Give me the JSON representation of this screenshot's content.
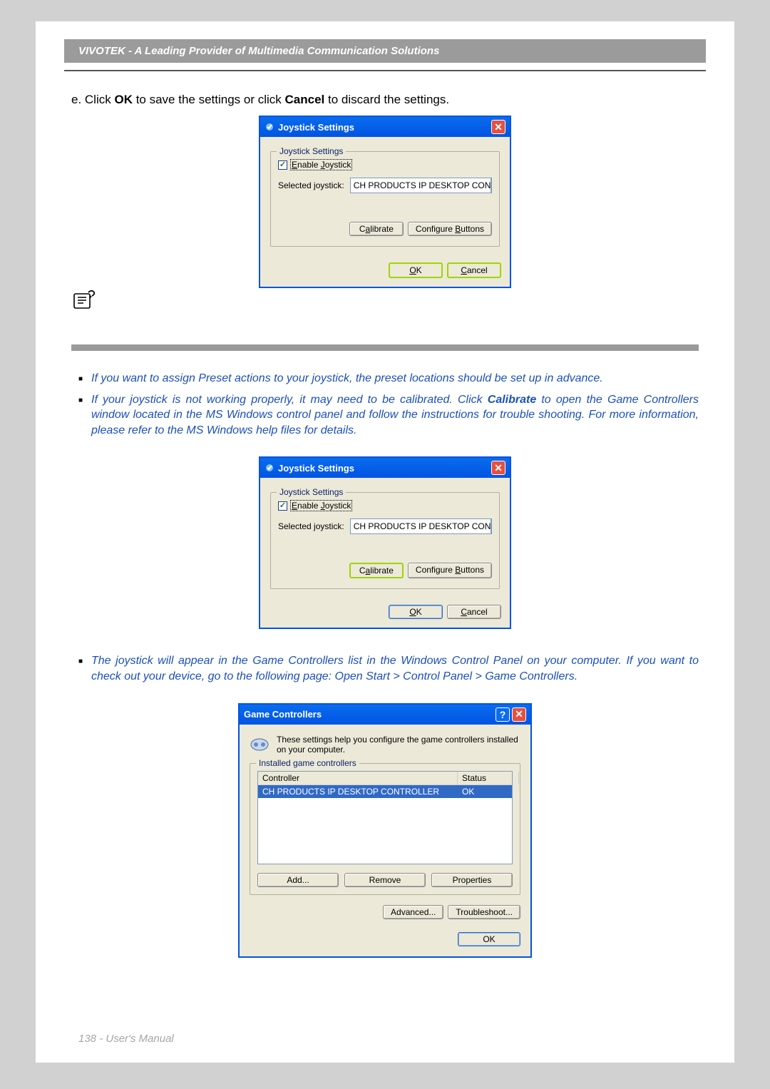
{
  "header": {
    "title": "VIVOTEK - A Leading Provider of Multimedia Communication Solutions"
  },
  "step": {
    "pre": "e. Click ",
    "ok": "OK",
    "mid": " to save the settings or click ",
    "cancel": "Cancel",
    "post": " to discard the settings."
  },
  "joystick_dialog": {
    "title": "Joystick Settings",
    "group_legend": "Joystick Settings",
    "enable_label_pre": "E",
    "enable_label_mid": "nable ",
    "enable_label_u2": "J",
    "enable_label_post": "oystick",
    "selected_label": "Selected joystick:",
    "selected_value": "CH PRODUCTS IP DESKTOP CON",
    "calibrate_btn": "Calibrate",
    "configure_btn": "Configure Buttons",
    "ok_btn": "OK",
    "cancel_btn": "Cancel"
  },
  "notes": {
    "n1": "If you want to assign Preset actions to your joystick, the preset locations should be set up in advance.",
    "n2_pre": "If your joystick is not working properly, it may need to be calibrated. Click ",
    "n2_bold": "Calibrate",
    "n2_post": " to open the Game Controllers window located in the MS Windows control panel and follow the instructions for trouble shooting. For more information, please refer to the MS Windows help files for details.",
    "n3": "The joystick will appear in the Game Controllers list in the Windows Control Panel on your computer. If you want to check out your device, go to the following page: Open Start > Control Panel > Game Controllers."
  },
  "gc_dialog": {
    "title": "Game Controllers",
    "desc": "These settings help you configure the game controllers installed on your computer.",
    "legend": "Installed game controllers",
    "hdr_controller": "Controller",
    "hdr_status": "Status",
    "row_controller": "CH PRODUCTS IP DESKTOP CONTROLLER",
    "row_status": "OK",
    "add_btn": "Add...",
    "remove_btn": "Remove",
    "properties_btn": "Properties",
    "advanced_btn": "Advanced...",
    "troubleshoot_btn": "Troubleshoot...",
    "ok_btn": "OK"
  },
  "footer": {
    "text": "138 - User's Manual"
  }
}
